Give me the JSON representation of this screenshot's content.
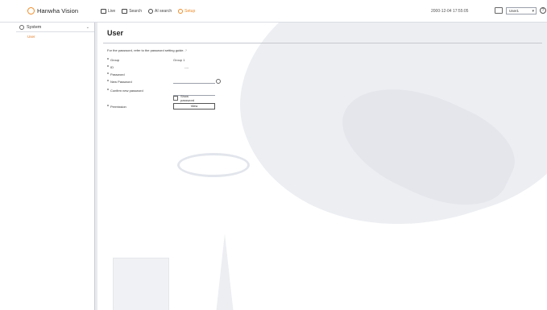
{
  "app": {
    "logo_text": "Hanwha Vision"
  },
  "nav": [
    {
      "label": "Live",
      "icon": "monitor-icon"
    },
    {
      "label": "Search",
      "icon": "search-icon"
    },
    {
      "label": "AI search",
      "icon": "ai-search-icon"
    },
    {
      "label": "Setup",
      "icon": "gear-icon",
      "active": true
    }
  ],
  "topbar": {
    "datetime": "2000-12-04 17:55:05",
    "user_select": "User1",
    "help": "?"
  },
  "sidebar": {
    "title": "System",
    "items": [
      {
        "label": "User"
      }
    ]
  },
  "page": {
    "title": "User",
    "guide": "For the password, refer to the password setting guide.",
    "guide_icon": "?",
    "fields": {
      "group_label": "Group",
      "group_value": "Group 1",
      "id_label": "ID",
      "id_value": "----",
      "password_label": "Password",
      "new_password_label": "New Password",
      "confirm_password_label": "Confirm new password",
      "show_password_label": "Show password",
      "permission_label": "Permission",
      "view_button": "View"
    }
  },
  "colors": {
    "accent": "#f08a24",
    "sidebar_item": "#e07b24"
  }
}
